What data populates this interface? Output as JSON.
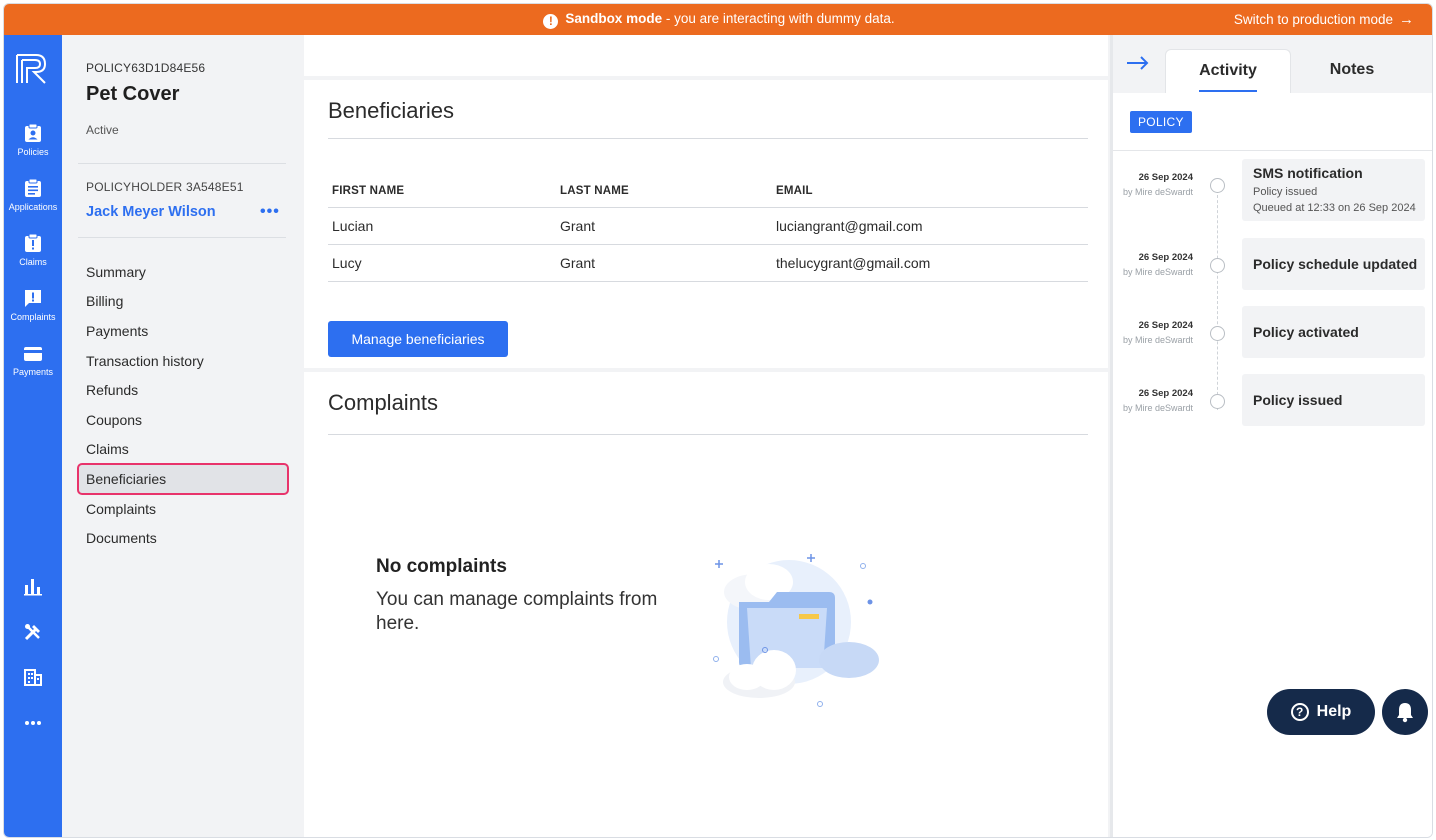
{
  "banner": {
    "mode_label": "Sandbox mode",
    "message": " - you are interacting with dummy data.",
    "switch_label": "Switch to production mode",
    "color": "#ec6a1f"
  },
  "rail": {
    "accent": "#2d6ff0",
    "items": [
      {
        "label": "Policies",
        "icon": "clipboard-person-icon"
      },
      {
        "label": "Applications",
        "icon": "clipboard-list-icon"
      },
      {
        "label": "Claims",
        "icon": "clipboard-alert-icon"
      },
      {
        "label": "Complaints",
        "icon": "chat-alert-icon"
      },
      {
        "label": "Payments",
        "icon": "credit-card-icon"
      }
    ],
    "bottom_icons": [
      "bar-chart-icon",
      "tools-icon",
      "building-icon",
      "more-icon"
    ]
  },
  "policy": {
    "id": "POLICY63D1D84E56",
    "name": "Pet Cover",
    "status": "Active",
    "holder_label": "POLICYHOLDER 3A548E51",
    "holder_name": "Jack Meyer Wilson"
  },
  "nav": {
    "items": [
      "Summary",
      "Billing",
      "Payments",
      "Transaction history",
      "Refunds",
      "Coupons",
      "Claims",
      "Beneficiaries",
      "Complaints",
      "Documents"
    ],
    "active": "Beneficiaries"
  },
  "beneficiaries": {
    "title": "Beneficiaries",
    "columns": [
      "FIRST NAME",
      "LAST NAME",
      "EMAIL"
    ],
    "rows": [
      [
        "Lucian",
        "Grant",
        "luciangrant@gmail.com"
      ],
      [
        "Lucy",
        "Grant",
        "thelucygrant@gmail.com"
      ]
    ],
    "manage_label": "Manage beneficiaries"
  },
  "complaints": {
    "title": "Complaints",
    "empty_title": "No complaints",
    "empty_text": "You can manage complaints from here."
  },
  "activity_panel": {
    "tabs": [
      "Activity",
      "Notes"
    ],
    "active_tab": "Activity",
    "badge": "POLICY",
    "events": [
      {
        "date": "26 Sep 2024",
        "by": "by Mire deSwardt",
        "title": "SMS notification",
        "lines": [
          "Policy issued",
          "Queued at 12:33 on 26 Sep 2024"
        ]
      },
      {
        "date": "26 Sep 2024",
        "by": "by Mire deSwardt",
        "title": "Policy schedule updated",
        "lines": []
      },
      {
        "date": "26 Sep 2024",
        "by": "by Mire deSwardt",
        "title": "Policy activated",
        "lines": []
      },
      {
        "date": "26 Sep 2024",
        "by": "by Mire deSwardt",
        "title": "Policy issued",
        "lines": []
      }
    ]
  },
  "floating": {
    "help_label": "Help"
  }
}
